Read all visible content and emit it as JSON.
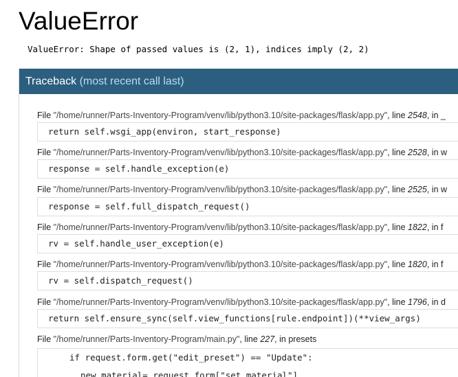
{
  "error": {
    "title": "ValueError",
    "message": "ValueError: Shape of passed values is (2, 1), indices imply (2, 2)"
  },
  "traceback": {
    "header_main": "Traceback",
    "header_sub": "(most recent call last)",
    "frames": [
      {
        "file_label": "File ",
        "path": "\"/home/runner/Parts-Inventory-Program/venv/lib/python3.10/site-packages/flask/app.py\"",
        "line_label": ", line ",
        "line": "2548",
        "in_label": ", in ",
        "func": "_",
        "code": "return self.wsgi_app(environ, start_response)"
      },
      {
        "file_label": "File ",
        "path": "\"/home/runner/Parts-Inventory-Program/venv/lib/python3.10/site-packages/flask/app.py\"",
        "line_label": ", line ",
        "line": "2528",
        "in_label": ", in ",
        "func": "w",
        "code": "response = self.handle_exception(e)"
      },
      {
        "file_label": "File ",
        "path": "\"/home/runner/Parts-Inventory-Program/venv/lib/python3.10/site-packages/flask/app.py\"",
        "line_label": ", line ",
        "line": "2525",
        "in_label": ", in ",
        "func": "w",
        "code": "response = self.full_dispatch_request()"
      },
      {
        "file_label": "File ",
        "path": "\"/home/runner/Parts-Inventory-Program/venv/lib/python3.10/site-packages/flask/app.py\"",
        "line_label": ", line ",
        "line": "1822",
        "in_label": ", in ",
        "func": "f",
        "code": "rv = self.handle_user_exception(e)"
      },
      {
        "file_label": "File ",
        "path": "\"/home/runner/Parts-Inventory-Program/venv/lib/python3.10/site-packages/flask/app.py\"",
        "line_label": ", line ",
        "line": "1820",
        "in_label": ", in ",
        "func": "f",
        "code": "rv = self.dispatch_request()"
      },
      {
        "file_label": "File ",
        "path": "\"/home/runner/Parts-Inventory-Program/venv/lib/python3.10/site-packages/flask/app.py\"",
        "line_label": ", line ",
        "line": "1796",
        "in_label": ", in ",
        "func": "d",
        "code": "return self.ensure_sync(self.view_functions[rule.endpoint])(**view_args)"
      },
      {
        "file_label": "File ",
        "path": "\"/home/runner/Parts-Inventory-Program/main.py\"",
        "line_label": ", line ",
        "line": "227",
        "in_label": ", in ",
        "func": "presets",
        "code_lines": [
          "if request.form.get(\"edit_preset\") == \"Update\":",
          "new_material= request.form[\"set_material\"]"
        ]
      }
    ]
  },
  "colors": {
    "header_bg": "#2c5f7f",
    "header_sub": "#b8dcef",
    "code_border": "#d8dfe3"
  }
}
